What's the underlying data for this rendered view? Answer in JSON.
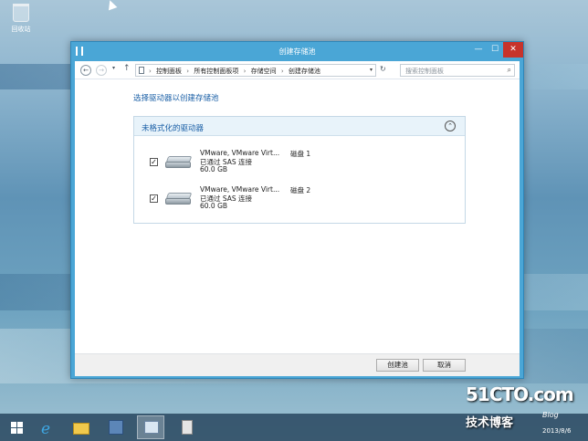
{
  "desktop": {
    "recycle_bin_label": "回收站"
  },
  "window": {
    "title": "创建存储池",
    "controls": {
      "minimize": "—",
      "maximize": "☐",
      "close": "✕"
    }
  },
  "navigation": {
    "back": "←",
    "forward": "→",
    "recent": "▾",
    "up": "↑",
    "breadcrumbs": [
      "控制面板",
      "所有控制面板项",
      "存储空间",
      "创建存储池"
    ],
    "separator": "›",
    "refresh": "↻",
    "search_placeholder": "搜索控制面板",
    "search_icon": "⌕"
  },
  "content": {
    "heading": "选择驱动器以创建存储池",
    "group": {
      "title": "未格式化的驱动器",
      "collapse_icon": "⌃",
      "drives": [
        {
          "checked": true,
          "name": "VMware, VMware Virt...",
          "disk": "磁盘 1",
          "connection": "已通过 SAS 连接",
          "size": "60.0 GB"
        },
        {
          "checked": true,
          "name": "VMware, VMware Virt...",
          "disk": "磁盘 2",
          "connection": "已通过 SAS 连接",
          "size": "60.0 GB"
        }
      ]
    }
  },
  "footer": {
    "create_label": "创建池",
    "cancel_label": "取消"
  },
  "taskbar": {
    "ie_glyph": "e",
    "items": [
      "start-icon",
      "internet-explorer-icon",
      "file-explorer-icon",
      "server-manager-icon",
      "control-panel-icon",
      "storage-app-icon"
    ]
  },
  "watermark": {
    "site": "51CTO.com",
    "blog_cn": "技术博客",
    "blog_en": "Blog",
    "date": "2013/8/6"
  },
  "checkmark": "✓"
}
